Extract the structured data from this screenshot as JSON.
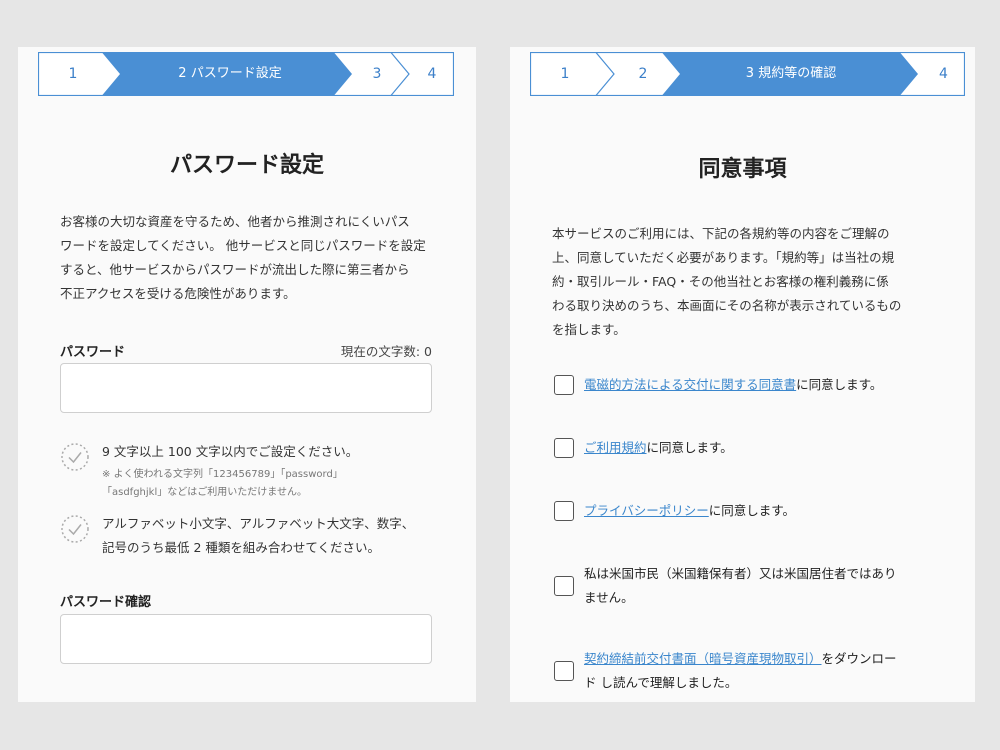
{
  "password_screen": {
    "stepper": {
      "steps": [
        "1",
        "2 パスワード設定",
        "3",
        "4"
      ],
      "active_index": 1
    },
    "title": "パスワード設定",
    "intro_lines": [
      "お客様の大切な資産を守るため、他者から推測されにくいパス",
      "ワードを設定してください。 他サービスと同じパスワードを設定",
      "すると、他サービスからパスワードが流出した際に第三者から",
      "不正アクセスを受ける危険性があります。"
    ],
    "password_label": "パスワード",
    "char_count_label": "現在の文字数: 0",
    "password_value": "",
    "rules": [
      {
        "icon": "dotted-check-circle-icon",
        "lines": [
          "9 文字以上 100 文字以内でご設定ください。"
        ],
        "note_lines": [
          "※ よく使われる文字列「123456789」「password」",
          "「asdfghjkl」などはご利用いただけません。"
        ]
      },
      {
        "icon": "dotted-check-circle-icon",
        "lines": [
          "アルファベット小文字、アルファベット大文字、数字、",
          "記号のうち最低 2 種類を組み合わせてください。"
        ],
        "note_lines": []
      }
    ],
    "confirm_label": "パスワード確認",
    "confirm_value": ""
  },
  "agreement_screen": {
    "stepper": {
      "steps": [
        "1",
        "2",
        "3 規約等の確認",
        "4"
      ],
      "active_index": 2
    },
    "title": "同意事項",
    "intro_lines": [
      "本サービスのご利用には、下記の各規約等の内容をご理解の",
      "上、同意していただく必要があります。「規約等」は当社の規",
      "約・取引ルール・FAQ・その他当社とお客様の権利義務に係",
      "わる取り決めのうち、本画面にその名称が表示されているもの",
      "を指します。"
    ],
    "items": [
      {
        "link": "電磁的方法による交付に関する同意書",
        "rest": "に同意します。",
        "line2": "",
        "checked": false
      },
      {
        "link": "ご利用規約",
        "rest": "に同意します。",
        "line2": "",
        "checked": false
      },
      {
        "link": "プライバシーポリシー",
        "rest": "に同意します。",
        "line2": "",
        "checked": false
      },
      {
        "link": "",
        "rest": "私は米国市民（米国籍保有者）又は米国居住者ではあり",
        "line2": "ません。",
        "checked": false
      },
      {
        "link": "契約締結前交付書面（暗号資産現物取引）",
        "rest": "をダウンロー",
        "line2": "ド し読んで理解しました。",
        "checked": false
      }
    ]
  },
  "colors": {
    "accent": "#4a8fd4",
    "link": "#3a86cc",
    "step_border": "#4a8fd4",
    "background": "#e6e6e6"
  }
}
